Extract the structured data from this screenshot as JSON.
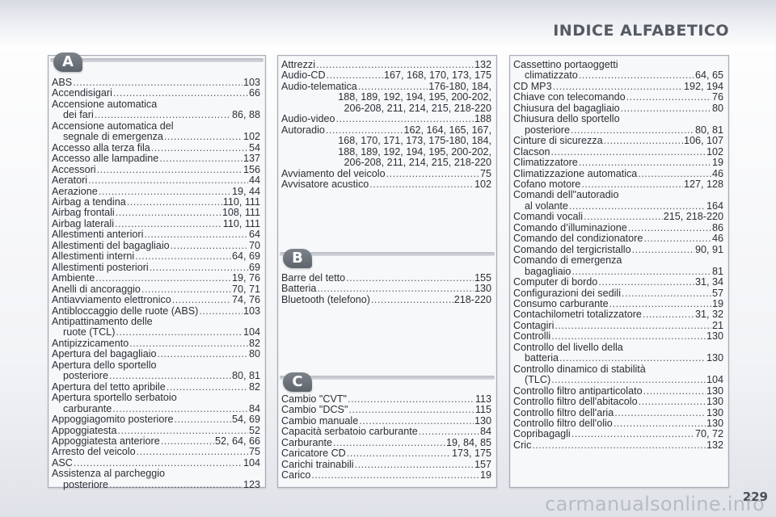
{
  "header": {
    "title": "INDICE ALFABETICO"
  },
  "page_number": "229",
  "watermark": "carmanualsonline.info",
  "sections": [
    {
      "letter": "A",
      "entries": [
        {
          "name": "ABS",
          "pages": "103"
        },
        {
          "name": "Accendisigari",
          "pages": "66"
        },
        {
          "name": "Accensione automatica",
          "name2": "dei fari",
          "pages": "86, 88"
        },
        {
          "name": "Accensione automatica del",
          "name2": "segnale di emergenza",
          "pages": "102"
        },
        {
          "name": "Accesso alla terza fila",
          "pages": "54"
        },
        {
          "name": "Accesso alle lampadine",
          "pages": "137"
        },
        {
          "name": "Accessori",
          "pages": "156"
        },
        {
          "name": "Aeratori",
          "pages": "44"
        },
        {
          "name": "Aerazione",
          "pages": "19, 44"
        },
        {
          "name": "Airbag a tendina",
          "pages": "110, 111"
        },
        {
          "name": "Airbag frontali",
          "pages": "108, 111"
        },
        {
          "name": "Airbag laterali",
          "pages": "110, 111"
        },
        {
          "name": "Allestimenti anteriori",
          "pages": "64"
        },
        {
          "name": "Allestimenti del bagagliaio",
          "pages": "70"
        },
        {
          "name": "Allestimenti interni",
          "pages": "64, 69"
        },
        {
          "name": "Allestimenti posteriori",
          "pages": "69"
        },
        {
          "name": "Ambiente",
          "pages": "19, 76"
        },
        {
          "name": "Anelli di ancoraggio",
          "pages": "70, 71"
        },
        {
          "name": "Antiavviamento elettronico",
          "pages": "74, 76"
        },
        {
          "name": "Antibloccaggio delle ruote (ABS)",
          "pages": "103"
        },
        {
          "name": "Antipattinamento delle",
          "name2": "ruote (TCL)",
          "pages": "104"
        },
        {
          "name": "Antipizzicamento",
          "pages": "82"
        },
        {
          "name": "Apertura del bagagliaio",
          "pages": "80"
        },
        {
          "name": "Apertura dello sportello",
          "name2": "posteriore",
          "pages": "80, 81"
        },
        {
          "name": "Apertura del tetto apribile",
          "pages": "82"
        },
        {
          "name": "Apertura sportello serbatoio",
          "name2": "carburante",
          "pages": "84"
        },
        {
          "name": "Appoggiagomito posteriore",
          "pages": "54, 69"
        },
        {
          "name": "Appoggiatesta",
          "pages": "52"
        },
        {
          "name": "Appoggiatesta anteriore",
          "pages": "52, 64, 66"
        },
        {
          "name": "Arresto del veicolo",
          "pages": "75"
        },
        {
          "name": "ASC",
          "pages": "104"
        },
        {
          "name": "Assistenza al parcheggio",
          "name2": "posteriore",
          "pages": "123"
        },
        {
          "name": "Attrezzi",
          "pages": "132"
        },
        {
          "name": "Audio-CD",
          "pages": "167, 168, 170, 173, 175"
        },
        {
          "name": "Audio-telematica",
          "pages": "176-180, 184,",
          "cont": [
            "188, 189, 192, 194, 195, 200-202,",
            "206-208, 211, 214, 215, 218-220"
          ]
        },
        {
          "name": "Audio-video",
          "pages": "188"
        },
        {
          "name": "Autoradio",
          "pages": "162, 164, 165, 167,",
          "cont": [
            "168, 170, 171, 173, 175-180, 184,",
            "188, 189, 192, 194, 195, 200-202,",
            "206-208, 211, 214, 215, 218-220"
          ]
        },
        {
          "name": "Avviamento del veicolo",
          "pages": "75"
        },
        {
          "name": "Avvisatore acustico",
          "pages": "102"
        }
      ]
    },
    {
      "letter": "B",
      "entries": [
        {
          "name": "Barre del tetto",
          "pages": "155"
        },
        {
          "name": "Batteria",
          "pages": "130"
        },
        {
          "name": "Bluetooth (telefono)",
          "pages": "218-220"
        }
      ]
    },
    {
      "letter": "C",
      "entries": [
        {
          "name": "Cambio \"CVT\"",
          "pages": "113"
        },
        {
          "name": "Cambio \"DCS\"",
          "pages": "115"
        },
        {
          "name": "Cambio manuale",
          "pages": "130"
        },
        {
          "name": "Capacità serbatoio carburante",
          "pages": "84"
        },
        {
          "name": "Carburante",
          "pages": "19, 84, 85"
        },
        {
          "name": "Caricatore CD",
          "pages": "173, 175"
        },
        {
          "name": "Carichi trainabili",
          "pages": "157"
        },
        {
          "name": "Carico",
          "pages": "19"
        },
        {
          "name": "Cassettino portaoggetti",
          "name2": "climatizzato",
          "pages": "64, 65"
        },
        {
          "name": "CD MP3",
          "pages": "192, 194"
        },
        {
          "name": "Chiave con telecomando",
          "pages": "76"
        },
        {
          "name": "Chiusura del bagagliaio",
          "pages": "80"
        },
        {
          "name": "Chiusura dello sportello",
          "name2": "posteriore",
          "pages": "80, 81"
        },
        {
          "name": "Cinture di sicurezza",
          "pages": "106, 107"
        },
        {
          "name": "Clacson",
          "pages": "102"
        },
        {
          "name": "Climatizzatore",
          "pages": "19"
        },
        {
          "name": "Climatizzazione automatica",
          "pages": "46"
        },
        {
          "name": "Cofano motore",
          "pages": "127, 128"
        },
        {
          "name": "Comandi dell\"autoradio",
          "name2": "al volante",
          "pages": "164"
        },
        {
          "name": "Comandi vocali",
          "pages": "215, 218-220"
        },
        {
          "name": "Comando d’illuminazione",
          "pages": "86"
        },
        {
          "name": "Comando del condizionatore",
          "pages": "46"
        },
        {
          "name": "Comando del tergicristallo",
          "pages": "90, 91"
        },
        {
          "name": "Comando di emergenza",
          "name2": "bagagliaio",
          "pages": "81"
        },
        {
          "name": "Computer di bordo",
          "pages": "31, 34"
        },
        {
          "name": "Configurazioni dei sedili",
          "pages": "57"
        },
        {
          "name": "Consumo carburante",
          "pages": "19"
        },
        {
          "name": "Contachilometri totalizzatore",
          "pages": "31, 32"
        },
        {
          "name": "Contagiri",
          "pages": "21"
        },
        {
          "name": "Controlli",
          "pages": "130"
        },
        {
          "name": "Controllo del livello della",
          "name2": "batteria",
          "pages": "130"
        },
        {
          "name": "Controllo dinamico di stabilità",
          "name2": "(TLC)",
          "pages": "104"
        },
        {
          "name": "Controllo filtro antiparticolato",
          "pages": "130"
        },
        {
          "name": "Controllo filtro dell'abitacolo",
          "pages": "130"
        },
        {
          "name": "Controllo filtro dell'aria",
          "pages": "130"
        },
        {
          "name": "Controllo filtro dell'olio",
          "pages": "130"
        },
        {
          "name": "Copribagagli",
          "pages": "70, 72"
        },
        {
          "name": "Cric",
          "pages": "132"
        }
      ]
    }
  ]
}
